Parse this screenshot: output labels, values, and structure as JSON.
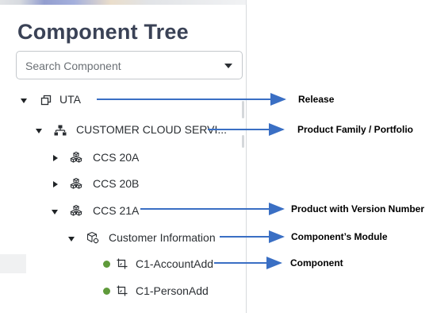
{
  "panel": {
    "title": "Component Tree",
    "search": {
      "placeholder": "Search Component"
    }
  },
  "tree": {
    "items": [
      {
        "label": "UTA",
        "icon": "release-icon",
        "state": "expanded"
      },
      {
        "label": "CUSTOMER CLOUD SERVI...",
        "icon": "hierarchy-icon",
        "state": "expanded"
      },
      {
        "label": "CCS 20A",
        "icon": "product-cubes-icon",
        "state": "collapsed"
      },
      {
        "label": "CCS 20B",
        "icon": "product-cubes-icon",
        "state": "collapsed"
      },
      {
        "label": "CCS 21A",
        "icon": "product-cubes-icon",
        "state": "expanded"
      },
      {
        "label": "Customer Information",
        "icon": "module-icon",
        "state": "expanded"
      },
      {
        "label": "C1-AccountAdd",
        "icon": "component-icon",
        "status_color": "#5f9a3a"
      },
      {
        "label": "C1-PersonAdd",
        "icon": "component-icon",
        "status_color": "#5f9a3a"
      }
    ]
  },
  "annotations": {
    "release": "Release",
    "product_family": "Product Family / Portfolio",
    "product_version": "Product with Version Number",
    "module": "Component’s Module",
    "component": "Component"
  },
  "colors": {
    "arrow": "#3a6fc4",
    "status_green": "#5f9a3a",
    "title": "#3a4256"
  }
}
